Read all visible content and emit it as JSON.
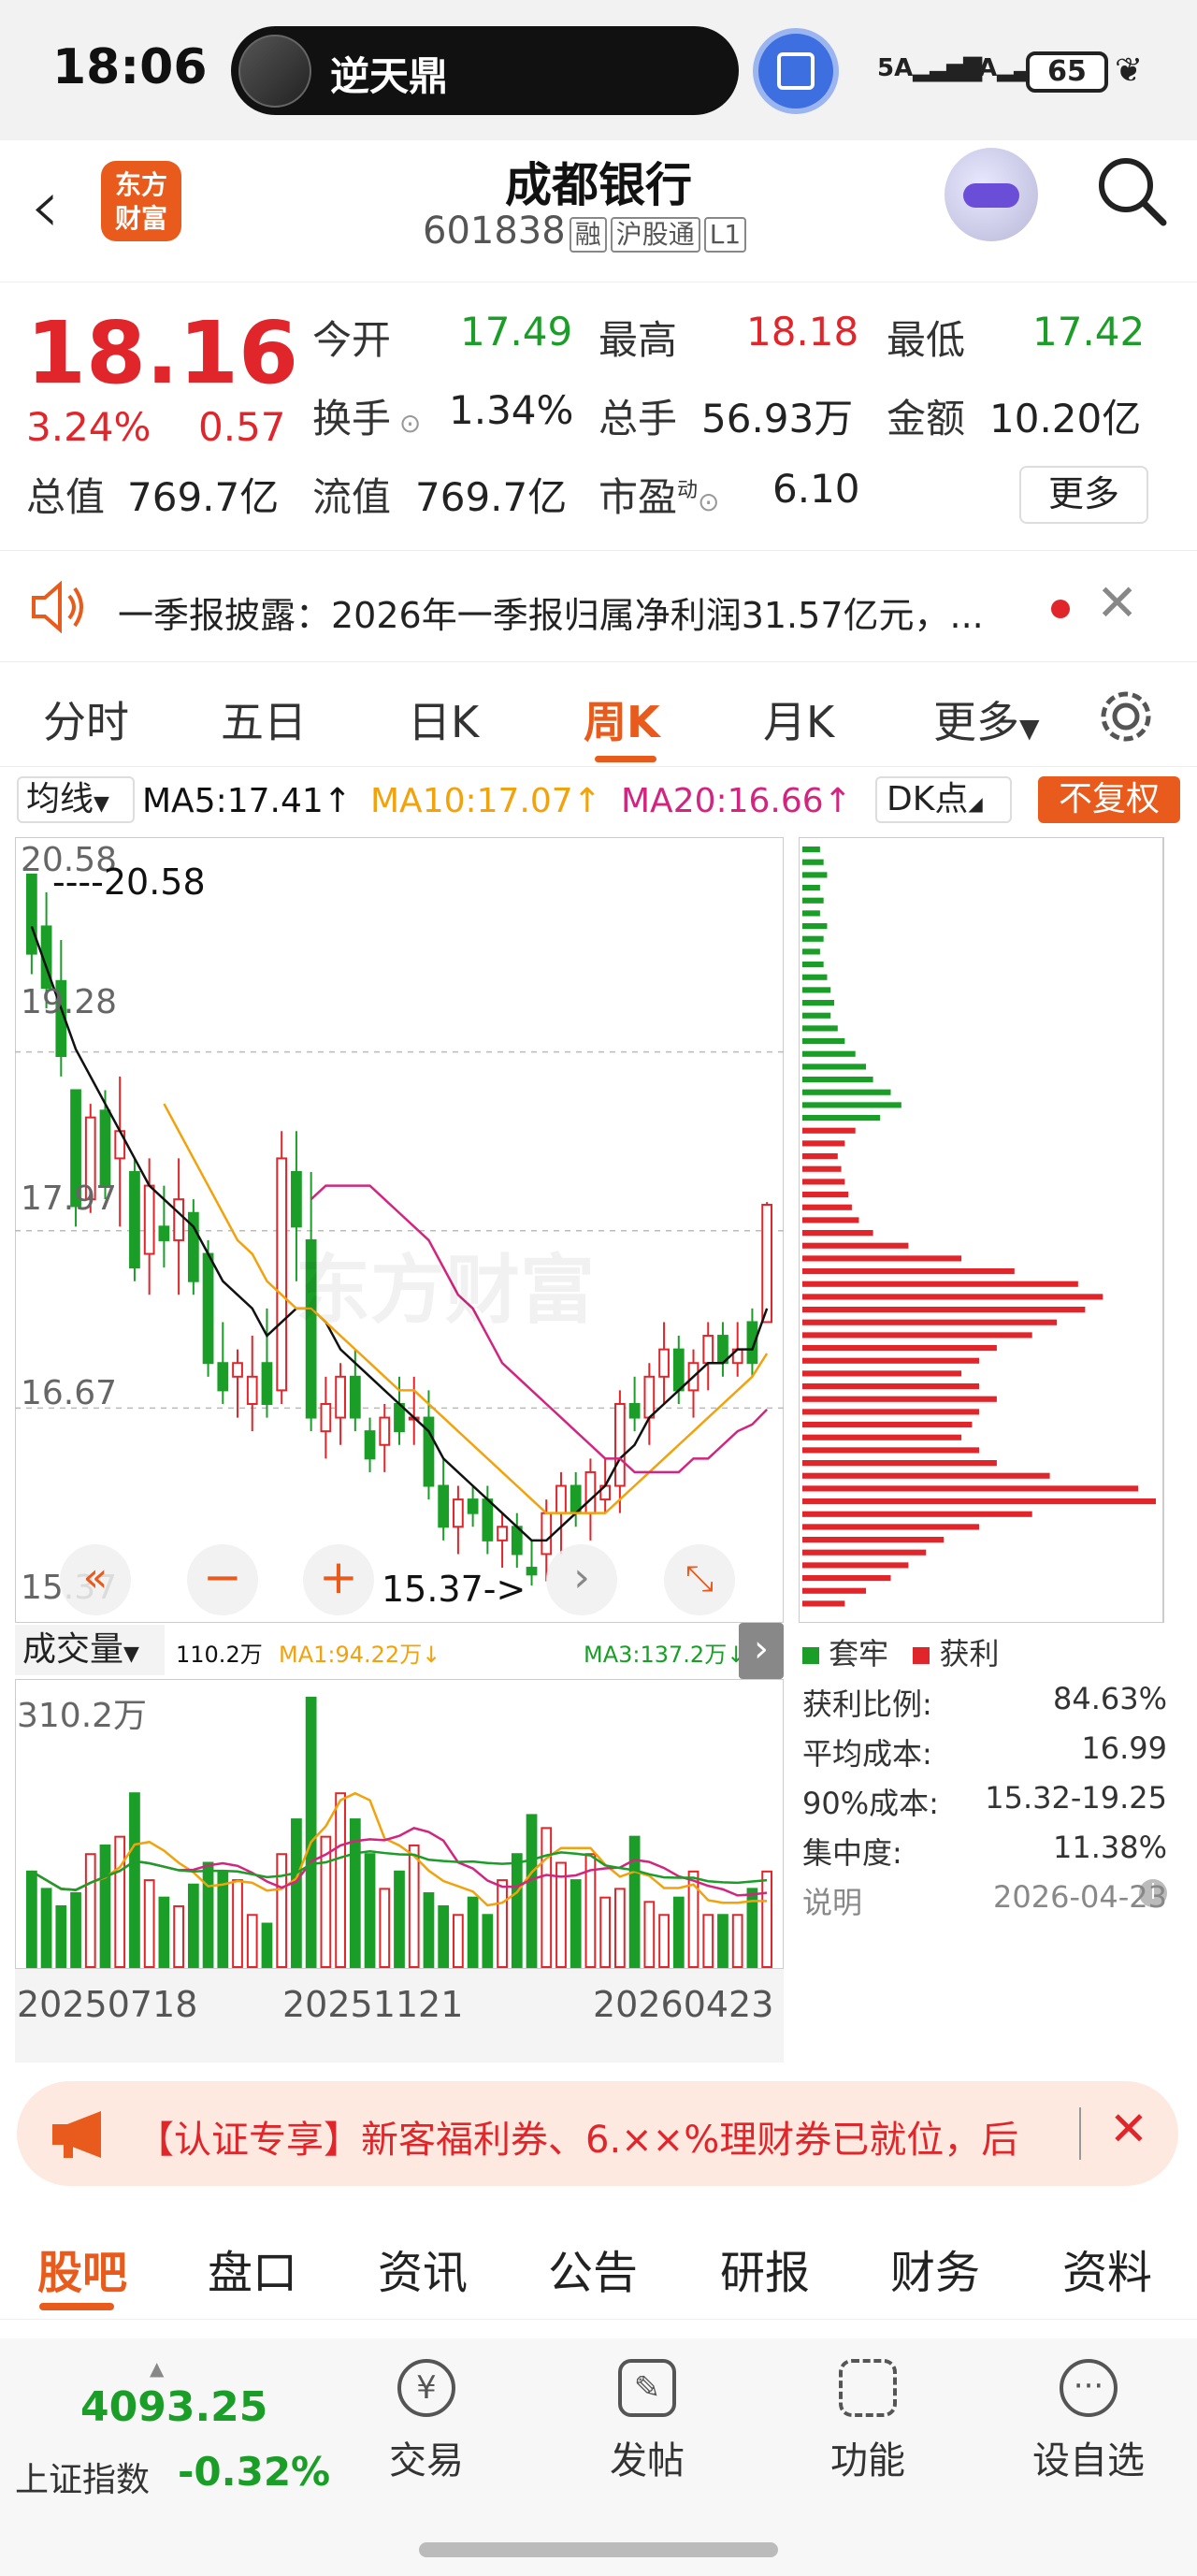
{
  "status_bar": {
    "time": "18:06",
    "pill_text": "逆天鼎",
    "net1": "5A",
    "net2": "5A",
    "battery": "65"
  },
  "header": {
    "logo_line1": "东方",
    "logo_line2": "财富",
    "title": "成都银行",
    "code": "601838",
    "tags": [
      "融",
      "沪股通",
      "L1"
    ]
  },
  "quote": {
    "price": "18.16",
    "change_pct": "3.24%",
    "change": "0.57",
    "open_label": "今开",
    "open": "17.49",
    "high_label": "最高",
    "high": "18.18",
    "low_label": "最低",
    "low": "17.42",
    "turnover_label": "换手",
    "turnover": "1.34%",
    "volume_label": "总手",
    "volume": "56.93万",
    "amount_label": "金额",
    "amount": "10.20亿",
    "mktcap_label": "总值",
    "mktcap": "769.7亿",
    "float_label": "流值",
    "float_cap": "769.7亿",
    "pe_label": "市盈",
    "pe_sup": "动",
    "pe": "6.10",
    "more_button": "更多"
  },
  "notice": {
    "text": "一季报披露：2026年一季报归属净利润31.57亿元，..."
  },
  "kline_tabs": [
    "分时",
    "五日",
    "日K",
    "周K",
    "月K",
    "更多"
  ],
  "kline_active": "周K",
  "ma_row": {
    "selector": "均线",
    "ma5": "MA5:17.41",
    "ma10": "MA10:17.07",
    "ma20": "MA20:16.66",
    "dk": "DK点",
    "adjust": "不复权"
  },
  "colors": {
    "green": "#1a9e28",
    "red": "#e0262b",
    "ma5": "#111111",
    "ma10": "#f2a20c",
    "ma20": "#d2257f",
    "accent": "#e85b1c"
  },
  "chart_data": {
    "type": "candlestick",
    "price_ticks": [
      "20.58",
      "19.28",
      "17.97",
      "16.67",
      "15.37"
    ],
    "high_marker": "----20.58",
    "low_marker": "15.37->",
    "x_ticks": [
      "20250718",
      "20251121",
      "20260423"
    ],
    "ohlc": [
      [
        20.58,
        20.58,
        19.85,
        20.0
      ],
      [
        20.2,
        20.45,
        19.6,
        19.75
      ],
      [
        19.8,
        20.1,
        19.1,
        19.25
      ],
      [
        19.0,
        19.0,
        18.0,
        18.15
      ],
      [
        18.2,
        18.9,
        18.1,
        18.8
      ],
      [
        18.85,
        19.0,
        18.2,
        18.3
      ],
      [
        18.5,
        19.1,
        18.0,
        18.7
      ],
      [
        18.4,
        18.5,
        17.6,
        17.7
      ],
      [
        17.8,
        18.5,
        17.5,
        18.3
      ],
      [
        18.0,
        18.3,
        17.7,
        17.9
      ],
      [
        17.9,
        18.5,
        17.5,
        18.2
      ],
      [
        18.1,
        18.2,
        17.5,
        17.6
      ],
      [
        17.8,
        17.9,
        16.9,
        17.0
      ],
      [
        17.0,
        17.3,
        16.7,
        16.8
      ],
      [
        16.9,
        17.1,
        16.6,
        17.0
      ],
      [
        16.7,
        17.2,
        16.5,
        16.9
      ],
      [
        17.0,
        17.4,
        16.6,
        16.7
      ],
      [
        16.8,
        18.7,
        16.7,
        18.5
      ],
      [
        18.4,
        18.7,
        17.6,
        18.0
      ],
      [
        17.9,
        18.4,
        16.5,
        16.6
      ],
      [
        16.5,
        16.9,
        16.3,
        16.7
      ],
      [
        16.6,
        17.0,
        16.4,
        16.9
      ],
      [
        16.9,
        17.1,
        16.5,
        16.6
      ],
      [
        16.5,
        16.6,
        16.2,
        16.3
      ],
      [
        16.4,
        16.7,
        16.2,
        16.6
      ],
      [
        16.7,
        16.9,
        16.4,
        16.5
      ],
      [
        16.6,
        16.9,
        16.4,
        16.6
      ],
      [
        16.6,
        16.8,
        16.0,
        16.1
      ],
      [
        16.1,
        16.3,
        15.7,
        15.8
      ],
      [
        15.8,
        16.1,
        15.6,
        16.0
      ],
      [
        16.0,
        16.1,
        15.8,
        15.9
      ],
      [
        16.0,
        16.1,
        15.6,
        15.7
      ],
      [
        15.7,
        15.9,
        15.5,
        15.8
      ],
      [
        15.8,
        15.9,
        15.5,
        15.6
      ],
      [
        15.5,
        15.7,
        15.37,
        15.45
      ],
      [
        15.6,
        16.0,
        15.4,
        15.9
      ],
      [
        15.9,
        16.2,
        15.6,
        16.1
      ],
      [
        16.1,
        16.2,
        15.8,
        15.9
      ],
      [
        15.9,
        16.3,
        15.7,
        16.2
      ],
      [
        16.0,
        16.3,
        15.9,
        16.1
      ],
      [
        16.1,
        16.8,
        15.9,
        16.7
      ],
      [
        16.7,
        16.9,
        16.5,
        16.6
      ],
      [
        16.6,
        17.0,
        16.4,
        16.9
      ],
      [
        16.9,
        17.3,
        16.7,
        17.1
      ],
      [
        17.1,
        17.2,
        16.7,
        16.8
      ],
      [
        16.8,
        17.1,
        16.6,
        17.0
      ],
      [
        17.0,
        17.3,
        16.8,
        17.2
      ],
      [
        17.2,
        17.3,
        16.9,
        17.0
      ],
      [
        17.0,
        17.3,
        16.9,
        17.1
      ],
      [
        17.3,
        17.4,
        16.9,
        17.0
      ],
      [
        17.3,
        18.18,
        17.3,
        18.16
      ]
    ],
    "ma5": [
      20.2,
      19.9,
      19.6,
      19.3,
      19.1,
      18.9,
      18.7,
      18.5,
      18.3,
      18.2,
      18.1,
      18.0,
      17.8,
      17.6,
      17.5,
      17.4,
      17.2,
      17.3,
      17.4,
      17.4,
      17.3,
      17.1,
      17.0,
      16.9,
      16.8,
      16.7,
      16.6,
      16.5,
      16.3,
      16.2,
      16.1,
      16.0,
      15.9,
      15.8,
      15.7,
      15.7,
      15.8,
      15.9,
      16.0,
      16.1,
      16.3,
      16.4,
      16.6,
      16.7,
      16.8,
      16.9,
      17.0,
      17.0,
      17.1,
      17.1,
      17.4
    ],
    "ma10": [
      null,
      null,
      null,
      null,
      null,
      null,
      null,
      null,
      null,
      18.9,
      18.7,
      18.5,
      18.3,
      18.1,
      17.9,
      17.8,
      17.6,
      17.5,
      17.4,
      17.4,
      17.3,
      17.2,
      17.1,
      17.0,
      16.9,
      16.8,
      16.8,
      16.7,
      16.6,
      16.5,
      16.4,
      16.3,
      16.2,
      16.1,
      16.0,
      15.9,
      15.9,
      15.9,
      15.9,
      15.9,
      16.0,
      16.1,
      16.2,
      16.3,
      16.4,
      16.5,
      16.6,
      16.7,
      16.8,
      16.9,
      17.07
    ],
    "ma20": [
      null,
      null,
      null,
      null,
      null,
      null,
      null,
      null,
      null,
      null,
      null,
      null,
      null,
      null,
      null,
      null,
      null,
      null,
      null,
      18.2,
      18.3,
      18.3,
      18.3,
      18.3,
      18.2,
      18.1,
      18.0,
      17.9,
      17.7,
      17.5,
      17.4,
      17.2,
      17.0,
      16.9,
      16.8,
      16.7,
      16.6,
      16.5,
      16.4,
      16.3,
      16.3,
      16.2,
      16.2,
      16.2,
      16.2,
      16.3,
      16.3,
      16.4,
      16.5,
      16.55,
      16.66
    ],
    "volume": {
      "label": "成交量",
      "current": "110.2万",
      "ma1": "MA1:94.22万↓",
      "ma3": "MA3:137.2万↓",
      "max_label": "310.2万",
      "values": [
        110,
        90,
        70,
        85,
        130,
        140,
        150,
        200,
        100,
        80,
        70,
        95,
        120,
        110,
        100,
        60,
        50,
        130,
        170,
        310,
        150,
        200,
        170,
        130,
        90,
        110,
        140,
        85,
        70,
        60,
        80,
        60,
        100,
        130,
        175,
        160,
        120,
        100,
        130,
        80,
        90,
        150,
        75,
        60,
        80,
        110,
        60,
        60,
        60,
        90,
        110
      ]
    },
    "chip_distribution": {
      "legend_loss": "套牢",
      "legend_profit": "获利",
      "rows": [
        0.05,
        0.06,
        0.07,
        0.05,
        0.06,
        0.05,
        0.07,
        0.06,
        0.05,
        0.06,
        0.07,
        0.08,
        0.09,
        0.08,
        0.1,
        0.12,
        0.15,
        0.18,
        0.2,
        0.25,
        0.28,
        0.22,
        0.15,
        0.12,
        0.1,
        0.11,
        0.12,
        0.13,
        0.14,
        0.16,
        0.2,
        0.3,
        0.45,
        0.6,
        0.78,
        0.85,
        0.8,
        0.72,
        0.65,
        0.55,
        0.5,
        0.45,
        0.5,
        0.55,
        0.5,
        0.48,
        0.45,
        0.5,
        0.55,
        0.7,
        0.95,
        1.0,
        0.65,
        0.5,
        0.4,
        0.35,
        0.3,
        0.25,
        0.18,
        0.12
      ],
      "profit_from_row": 22
    }
  },
  "stats": [
    {
      "label": "获利比例:",
      "value": "84.63%"
    },
    {
      "label": "平均成本:",
      "value": "16.99"
    },
    {
      "label": "90%成本:",
      "value": "15.32-19.25"
    },
    {
      "label": "集中度:",
      "value": "11.38%"
    },
    {
      "label": "说明",
      "value": "2026-04-23"
    }
  ],
  "promo": {
    "text": "【认证专享】新客福利券、6.××%理财券已就位，后"
  },
  "bottom_tabs": [
    "股吧",
    "盘口",
    "资讯",
    "公告",
    "研报",
    "财务",
    "资料"
  ],
  "bottom_bar": {
    "index_value": "4093.25",
    "index_name": "上证指数",
    "index_change": "-0.32%",
    "trade": "交易",
    "post": "发帖",
    "func": "功能",
    "watch": "设自选"
  },
  "watermark": "东方财富"
}
